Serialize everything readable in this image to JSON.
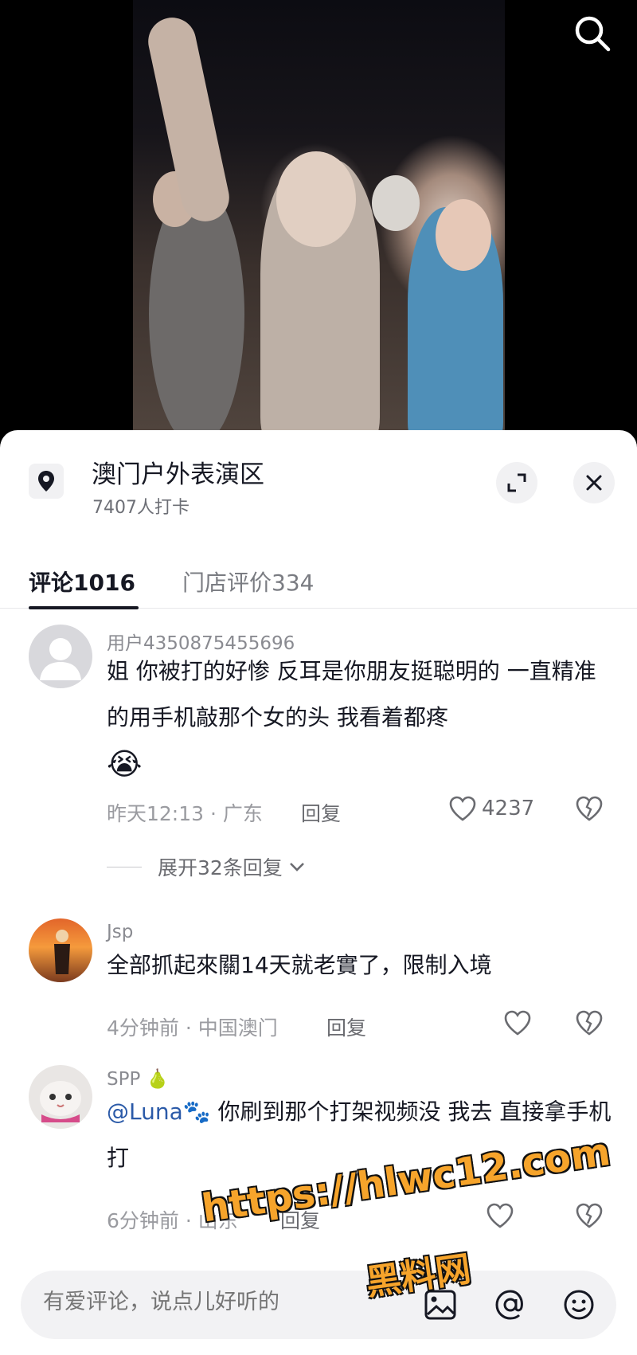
{
  "location": {
    "title": "澳门户外表演区",
    "checkins": "7407人打卡"
  },
  "tabs": [
    {
      "label": "评论1016",
      "active": true
    },
    {
      "label": "门店评价334",
      "active": false
    }
  ],
  "comments": [
    {
      "user": "用户4350875455696",
      "text": "姐 你被打的好惨 反耳是你朋友挺聪明的 一直精准的用手机敲那个女的头 我看着都疼",
      "emoji": "😭",
      "meta": "昨天12:13 · 广东",
      "reply_label": "回复",
      "likes": "4237",
      "expand_label": "展开32条回复"
    },
    {
      "user": "Jsp",
      "text": "全部抓起來關14天就老實了，限制入境",
      "meta": "4分钟前 · 中国澳门",
      "reply_label": "回复",
      "likes": ""
    },
    {
      "user": "SPP",
      "user_badge": "🍐",
      "mention": "@Luna🐾",
      "text": " 你刷到那个打架视频没 我去 直接拿手机打",
      "meta": "6分钟前 · 山东",
      "reply_label": "回复",
      "likes": ""
    }
  ],
  "input": {
    "placeholder": "有爱评论，说点儿好听的"
  },
  "watermark": {
    "line1": "https://hlwc12.com",
    "line2": "黑料网"
  },
  "colors": {
    "primary_text": "#161823",
    "secondary_text": "#8a8b91",
    "mention": "#2b5aa8",
    "watermark": "#f6a42b"
  },
  "icons": {
    "search": "search-icon",
    "location": "location-pin-icon",
    "expand": "expand-icon",
    "close": "close-icon",
    "like": "heart-icon",
    "dislike": "broken-heart-icon",
    "image": "image-icon",
    "mention": "at-icon",
    "emoji": "emoji-icon",
    "chevron": "chevron-down-icon"
  }
}
